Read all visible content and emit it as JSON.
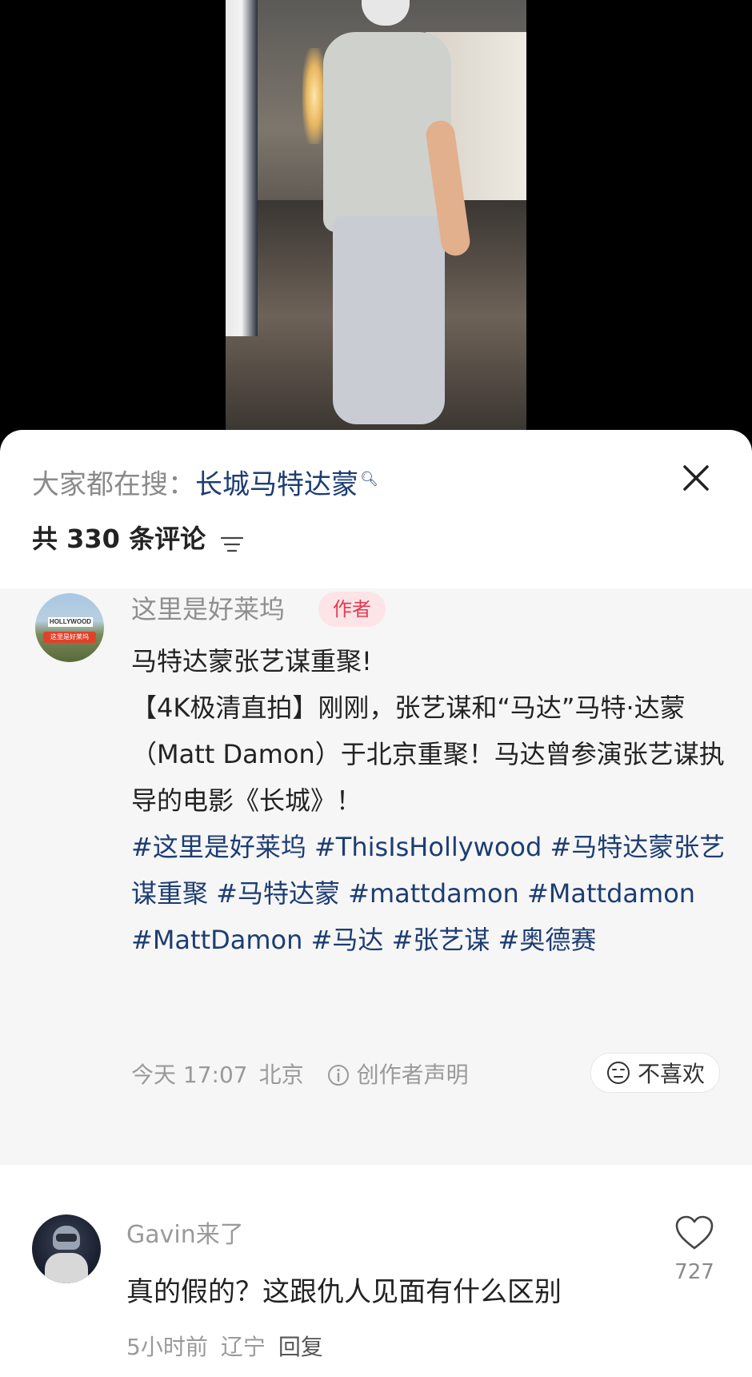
{
  "search": {
    "prefix": "大家都在搜：",
    "term": "长城马特达蒙",
    "term_icon": "search-icon"
  },
  "comments_header": {
    "count_label": "共 330 条评论",
    "sort_icon": "sort-icon"
  },
  "post": {
    "author": "这里是好莱坞",
    "badge": "作者",
    "avatar_sign": "HOLLYWOOD",
    "avatar_banner": "这里是好莱坞",
    "headline": "马特达蒙张艺谋重聚!",
    "body": "【4K极清直拍】刚刚，张艺谋和“马达”马特·达蒙（Matt Damon）于北京重聚！马达曾参演张艺谋执导的电影《长城》！",
    "hashtags": "#这里是好莱坞 #ThisIsHollywood #马特达蒙张艺谋重聚 #马特达蒙 #mattdamon #Mattdamon #MattDamon #马达 #张艺谋 #奥德赛",
    "time": "今天 17:07",
    "location": "北京",
    "declaration": "创作者声明",
    "dislike_label": "不喜欢"
  },
  "comment": {
    "user": "Gavin来了",
    "text": "真的假的？这跟仇人见面有什么区别",
    "time": "5小时前",
    "location": "辽宁",
    "reply_label": "回复",
    "likes": "727"
  },
  "colors": {
    "link": "#1d3d72",
    "badge_bg": "#fde4e7",
    "badge_text": "#e23b53",
    "post_bg": "#f6f6f6"
  }
}
